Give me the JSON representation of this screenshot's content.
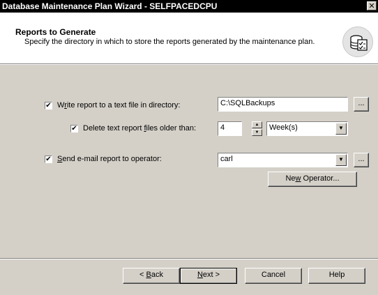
{
  "window": {
    "title": "Database Maintenance Plan Wizard - SELFPACEDCPU",
    "close_glyph": "✕"
  },
  "header": {
    "title": "Reports to Generate",
    "description": "Specify the directory in which to store the reports generated by the maintenance plan.",
    "icon": "database-checklist-icon"
  },
  "form": {
    "write_report": {
      "checked": true,
      "label_pre": "W",
      "label_key": "r",
      "label_post": "ite report to a text file in directory:",
      "directory": "C:\\SQLBackups",
      "browse_label": "..."
    },
    "delete_old": {
      "checked": true,
      "label_pre": "Delete text report ",
      "label_key": "f",
      "label_post": "iles older than:",
      "count": "4",
      "unit": "Week(s)"
    },
    "send_email": {
      "checked": true,
      "label_pre": "",
      "label_key": "S",
      "label_post": "end e-mail report to operator:",
      "operator": "carl",
      "browse_label": "..."
    },
    "new_operator": {
      "pre": "Ne",
      "key": "w",
      "post": " Operator..."
    }
  },
  "footer": {
    "back": {
      "pre": "< ",
      "key": "B",
      "post": "ack"
    },
    "next": {
      "pre": "",
      "key": "N",
      "post": "ext >"
    },
    "cancel": "Cancel",
    "help": "Help"
  }
}
